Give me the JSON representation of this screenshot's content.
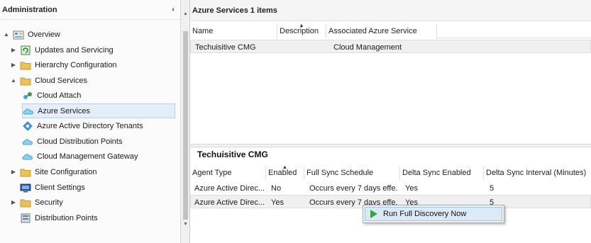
{
  "nav": {
    "title": "Administration",
    "collapse_glyph": "‹",
    "items": [
      {
        "label": "Overview",
        "icon": "overview-icon",
        "expander": "▲"
      },
      {
        "label": "Updates and Servicing",
        "icon": "updates-servicing-icon",
        "expander": "▶"
      },
      {
        "label": "Hierarchy Configuration",
        "icon": "folder-icon",
        "expander": "▶"
      },
      {
        "label": "Cloud Services",
        "icon": "folder-icon",
        "expander": "▲"
      },
      {
        "label": "Cloud Attach",
        "icon": "cloud-attach-icon"
      },
      {
        "label": "Azure Services",
        "icon": "cloud-icon",
        "selected": true
      },
      {
        "label": "Azure Active Directory Tenants",
        "icon": "aad-tenant-icon"
      },
      {
        "label": "Cloud Distribution Points",
        "icon": "cloud-icon"
      },
      {
        "label": "Cloud Management Gateway",
        "icon": "cloud-icon"
      },
      {
        "label": "Site Configuration",
        "icon": "folder-icon",
        "expander": "▶"
      },
      {
        "label": "Client Settings",
        "icon": "client-settings-icon"
      },
      {
        "label": "Security",
        "icon": "folder-icon",
        "expander": "▶"
      },
      {
        "label": "Distribution Points",
        "icon": "distribution-points-icon"
      }
    ]
  },
  "list": {
    "header": "Azure Services 1 items",
    "columns": [
      "Name",
      "Description",
      "Associated Azure Service"
    ],
    "rows": [
      {
        "name": "Techuisitive CMG",
        "description": "",
        "service": "Cloud Management"
      }
    ]
  },
  "details": {
    "title": "Techuisitive CMG",
    "columns": [
      "Agent Type",
      "Enabled",
      "Full Sync Schedule",
      "Delta Sync Enabled",
      "Delta Sync Interval (Minutes)"
    ],
    "rows": [
      {
        "agent_type": "Azure Active Direc...",
        "enabled": "No",
        "schedule": "Occurs every 7 days effe...",
        "delta_enabled": "Yes",
        "interval": "5"
      },
      {
        "agent_type": "Azure Active Direc...",
        "enabled": "Yes",
        "schedule": "Occurs every 7 days effe...",
        "delta_enabled": "Yes",
        "interval": "5"
      }
    ]
  },
  "context_menu": {
    "item_label": "Run Full Discovery Now",
    "item_icon": "play-icon"
  },
  "colors": {
    "selection_bg": "#e5eef8",
    "folder": "#e8c25a",
    "cloud": "#5fb3d6",
    "play": "#35a24a"
  }
}
